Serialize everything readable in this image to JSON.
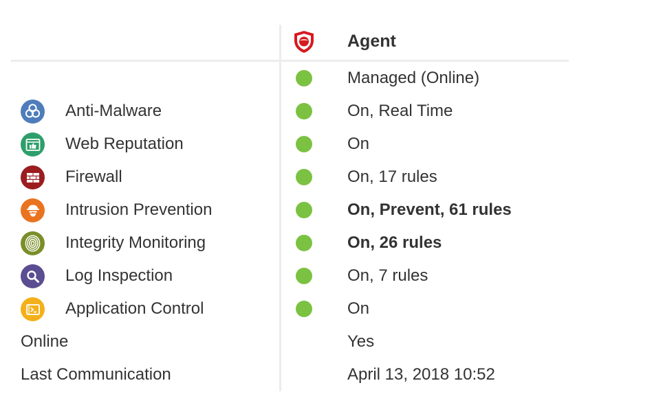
{
  "header": {
    "column_title": "Agent",
    "shield_icon": "trend-micro-shield-icon",
    "shield_color": "#d71920"
  },
  "status_color": "#7cc242",
  "status_row": {
    "value": "Managed (Online)"
  },
  "modules": [
    {
      "name": "Anti-Malware",
      "icon": "biohazard-icon",
      "color": "#4f7dbb",
      "value": "On, Real Time",
      "bold": false
    },
    {
      "name": "Web Reputation",
      "icon": "thumbs-up-browser-icon",
      "color": "#2e9e6a",
      "value": "On",
      "bold": false
    },
    {
      "name": "Firewall",
      "icon": "brick-wall-icon",
      "color": "#9b1d20",
      "value": "On, 17 rules",
      "bold": false
    },
    {
      "name": "Intrusion Prevention",
      "icon": "intruder-mask-icon",
      "color": "#e9731f",
      "value": "On, Prevent, 61 rules",
      "bold": true
    },
    {
      "name": "Integrity Monitoring",
      "icon": "fingerprint-icon",
      "color": "#7a8f2a",
      "value": "On, 26 rules",
      "bold": true
    },
    {
      "name": "Log Inspection",
      "icon": "magnifier-icon",
      "color": "#5b4d92",
      "value": "On, 7 rules",
      "bold": false
    },
    {
      "name": "Application Control",
      "icon": "terminal-window-icon",
      "color": "#f4b01a",
      "value": "On",
      "bold": false
    }
  ],
  "info_rows": [
    {
      "label": "Online",
      "value": "Yes"
    },
    {
      "label": "Last Communication",
      "value": "April 13, 2018 10:52"
    }
  ]
}
